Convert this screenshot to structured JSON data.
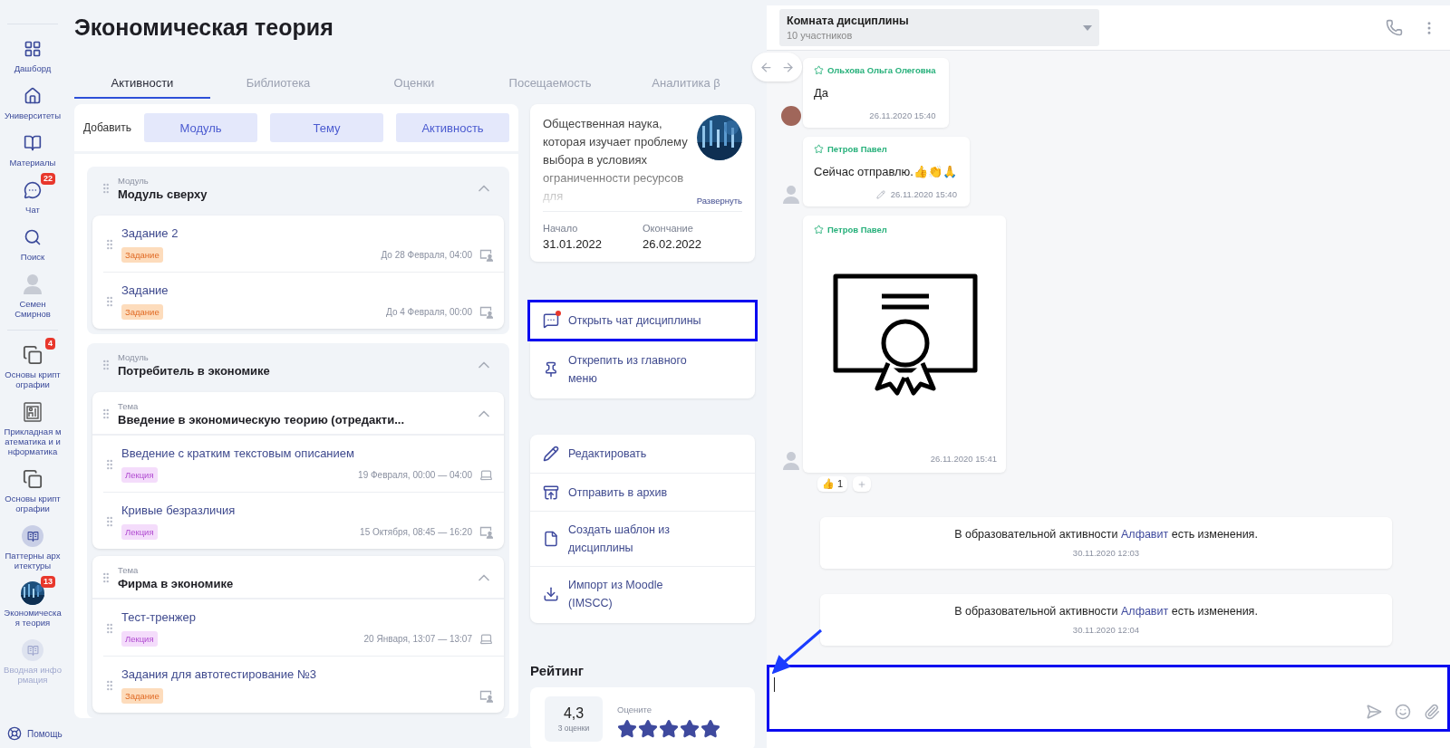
{
  "sidebar": {
    "nav": [
      {
        "kind": "grid",
        "label": "Дашборд"
      },
      {
        "kind": "home",
        "label": "Университеты"
      },
      {
        "kind": "book",
        "label": "Материалы"
      },
      {
        "kind": "chat",
        "label": "Чат",
        "badge": "22"
      },
      {
        "kind": "search",
        "label": "Поиск"
      },
      {
        "kind": "user",
        "label": "Семен Смирнов"
      }
    ],
    "courses": [
      {
        "kind": "stack",
        "label": "Основы криптографии",
        "badge": "4"
      },
      {
        "kind": "board",
        "label": "Прикладная математика и информатика"
      },
      {
        "kind": "stack",
        "label": "Основы криптографии"
      },
      {
        "kind": "book",
        "label": "Паттерны архитектуры"
      },
      {
        "kind": "picture",
        "label": "Экономическая теория",
        "badge": "13"
      },
      {
        "kind": "book",
        "label": "Вводная информация"
      }
    ],
    "help": "Помощь"
  },
  "page": {
    "title": "Экономическая теория"
  },
  "tabs": [
    {
      "label": "Активности",
      "selected": true
    },
    {
      "label": "Библиотека",
      "selected": false
    },
    {
      "label": "Оценки",
      "selected": false
    },
    {
      "label": "Посещаемость",
      "selected": false
    },
    {
      "label": "Аналитика β",
      "selected": false
    }
  ],
  "add_bar": {
    "label": "Добавить",
    "buttons": [
      "Модуль",
      "Тему",
      "Активность"
    ]
  },
  "modules": [
    {
      "label": "Модуль",
      "title": "Модуль сверху",
      "expanded": true,
      "items": [
        {
          "title": "Задание 2",
          "tag": {
            "kind": "task",
            "label": "Задание"
          },
          "date": "До 28 Февраля, 04:00",
          "kind": "classroom"
        },
        {
          "title": "Задание",
          "tag": {
            "kind": "task",
            "label": "Задание"
          },
          "date": "До 4 Февраля, 00:00",
          "kind": "classroom"
        }
      ]
    },
    {
      "label": "Модуль",
      "title": "Потребитель в экономике",
      "expanded": true,
      "topics": [
        {
          "label": "Тема",
          "title": "Введение в экономическую теорию (отредакти...",
          "expanded": true,
          "items": [
            {
              "title": "Введение с кратким текстовым описанием",
              "tag": {
                "kind": "lecture",
                "label": "Лекция"
              },
              "date": "19 Февраля, 00:00 — 04:00",
              "kind": "online"
            },
            {
              "title": "Кривые безразличия",
              "tag": {
                "kind": "lecture",
                "label": "Лекция"
              },
              "date": "15 Октября, 08:45 — 16:20",
              "kind": "classroom"
            }
          ]
        },
        {
          "label": "Тема",
          "title": "Фирма в экономике",
          "expanded": true,
          "items": [
            {
              "title": "Тест-тренжер",
              "tag": {
                "kind": "lecture",
                "label": "Лекция"
              },
              "date": "20 Января, 13:07 — 13:07",
              "kind": "online"
            },
            {
              "title": "Задания для автотестирование №3",
              "tag": {
                "kind": "task",
                "label": "Задание"
              },
              "kind": "classroom"
            }
          ]
        }
      ]
    }
  ],
  "description": {
    "text": "Общественная наука, которая изучает проблему выбора в условиях ограниченности ресурсов для",
    "expand": "Развернуть",
    "start_label": "Начало",
    "start": "31.01.2022",
    "end_label": "Окончание",
    "end": "26.02.2022"
  },
  "action_groups": [
    {
      "items": [
        {
          "kind": "chat",
          "label": "Открыть чат дисциплины",
          "highlighted": true,
          "unread": true
        },
        {
          "kind": "pin",
          "label": "Открепить из главного меню",
          "highlighted": false
        }
      ]
    },
    {
      "items": [
        {
          "kind": "edit",
          "label": "Редактировать",
          "highlighted": false
        },
        {
          "kind": "archive",
          "label": "Отправить в архив",
          "highlighted": false
        },
        {
          "kind": "template",
          "label": "Создать шаблон из дисциплины",
          "highlighted": false
        },
        {
          "kind": "import",
          "label": "Импорт из Moodle (IMSCC)",
          "highlighted": false
        }
      ]
    }
  ],
  "rating": {
    "heading": "Рейтинг",
    "score": "4,3",
    "count": "3 оценки",
    "prompt": "Оцените",
    "stars": 5
  },
  "chat": {
    "title": "Комната дисциплины",
    "subtitle": "10 участников",
    "messages": [
      {
        "kind": "text",
        "author": "Ольхова Ольга Олеговна",
        "text": "Да",
        "time": "26.11.2020 15:40",
        "edited": false
      },
      {
        "kind": "text",
        "author": "Петров Павел",
        "avatar": {
          "kind": "default"
        },
        "text": "Сейчас отправлю.👍👏🙏",
        "time": "26.11.2020 15:40",
        "edited": true
      },
      {
        "author": "Петров Павел",
        "avatar": {
          "kind": "default"
        },
        "time": "26.11.2020 15:41",
        "reactions": [
          {
            "emoji": "👍",
            "count": "1"
          }
        ]
      },
      {
        "kind": "system",
        "prefix": "В образовательной активности",
        "link": "Алфавит",
        "suffix": "есть изменения.",
        "time": "30.11.2020 12:03"
      },
      {
        "kind": "system",
        "prefix": "В образовательной активности",
        "link": "Алфавит",
        "suffix": "есть изменения.",
        "time": "30.11.2020 12:04"
      }
    ],
    "composer": {
      "focused": true,
      "highlighted": true,
      "pointer_arrow": true
    }
  }
}
